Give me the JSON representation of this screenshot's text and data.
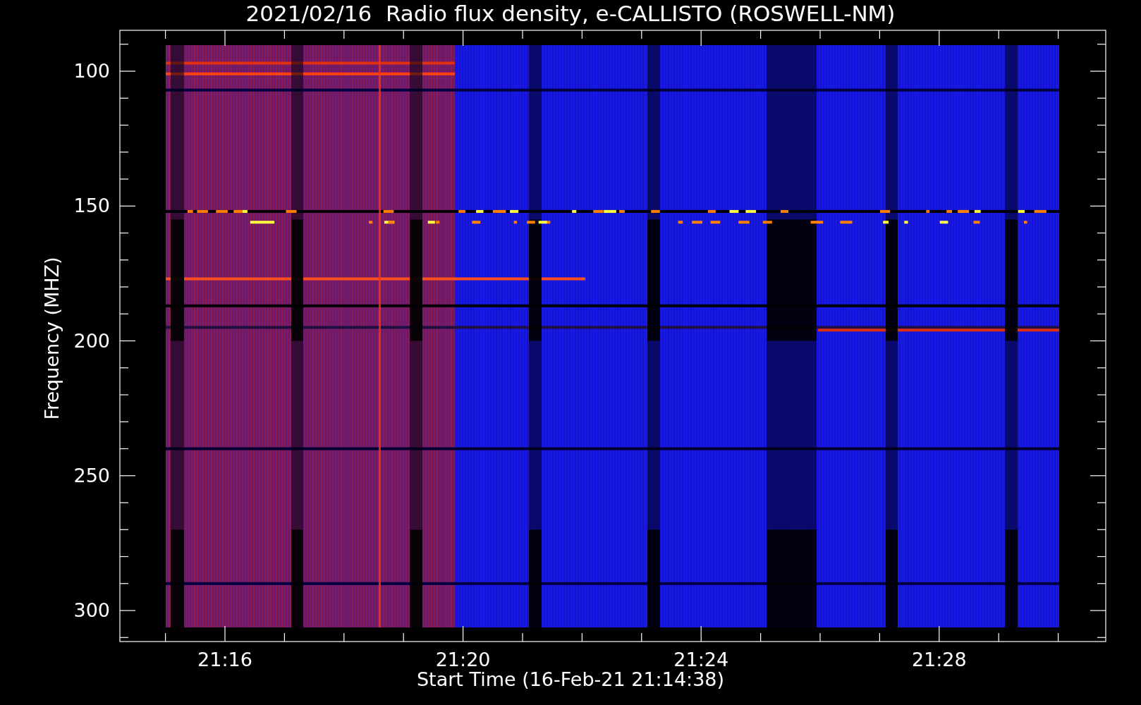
{
  "title": "2021/02/16  Radio flux density, e-CALLISTO (ROSWELL-NM)",
  "y_axis": {
    "label": "Frequency (MHZ)",
    "ticks": [
      "100",
      "150",
      "200",
      "250",
      "300"
    ]
  },
  "x_axis": {
    "label": "Start Time (16-Feb-21 21:14:38)",
    "ticks": [
      "21:16",
      "21:20",
      "21:24",
      "21:28"
    ]
  }
}
